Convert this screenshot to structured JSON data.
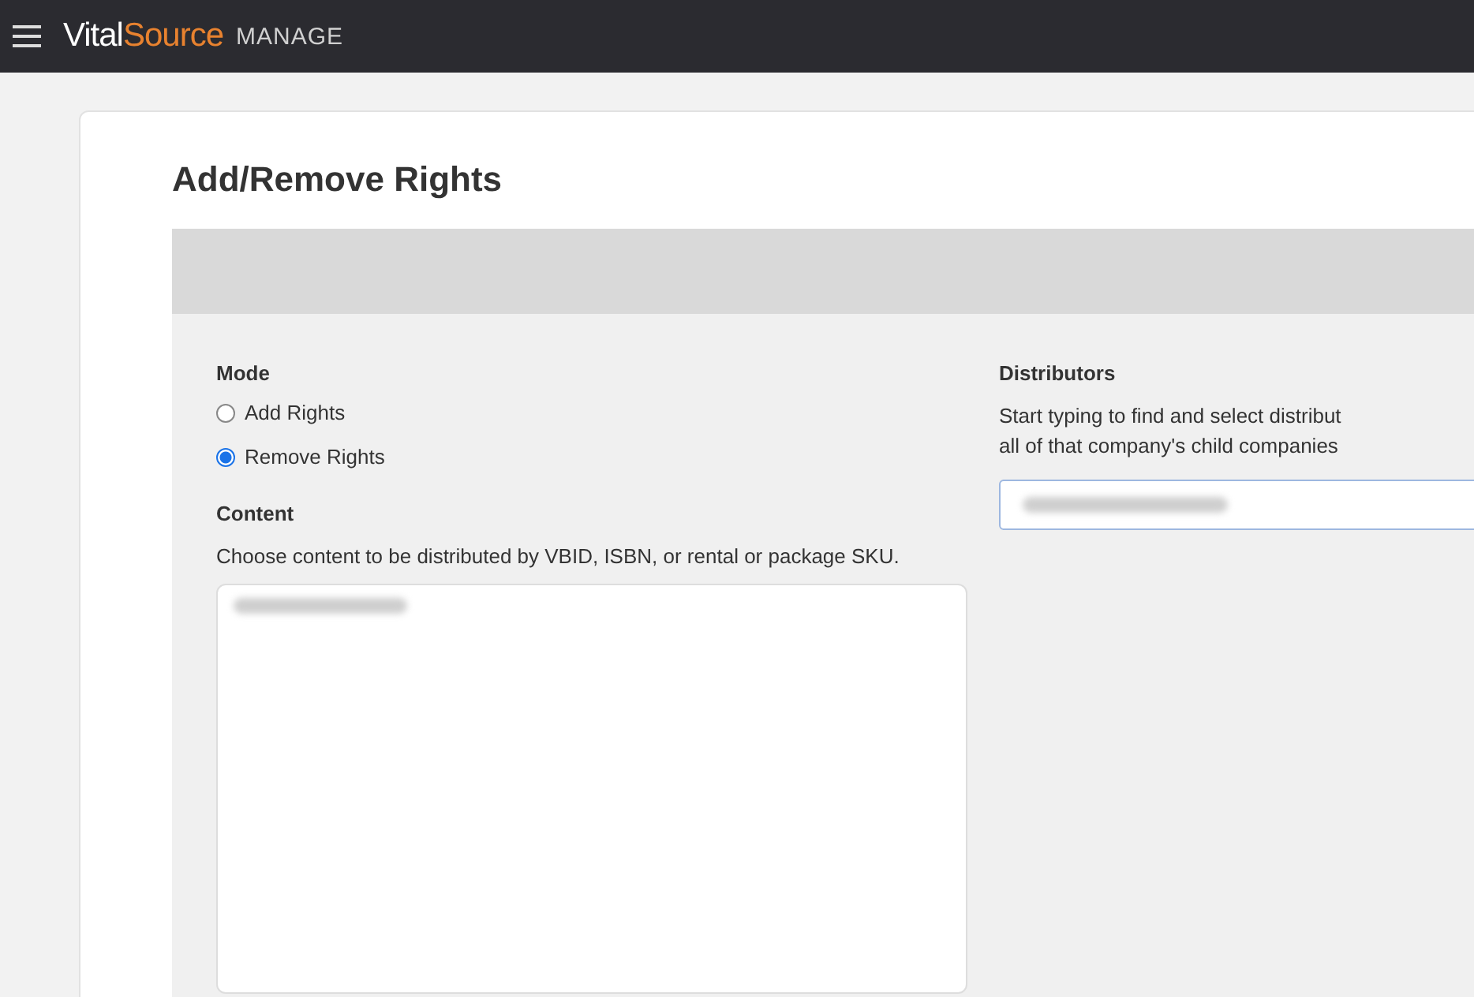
{
  "header": {
    "brand_first": "Vital",
    "brand_second": "Source",
    "product": "MANAGE"
  },
  "page": {
    "title": "Add/Remove Rights"
  },
  "mode": {
    "label": "Mode",
    "options": [
      {
        "label": "Add Rights",
        "selected": false
      },
      {
        "label": "Remove Rights",
        "selected": true
      }
    ]
  },
  "content": {
    "label": "Content",
    "help": "Choose content to be distributed by VBID, ISBN, or rental or package SKU."
  },
  "distributors": {
    "label": "Distributors",
    "help_lines": [
      "Start typing to find and select distribut",
      "all of that company's child companies"
    ]
  }
}
